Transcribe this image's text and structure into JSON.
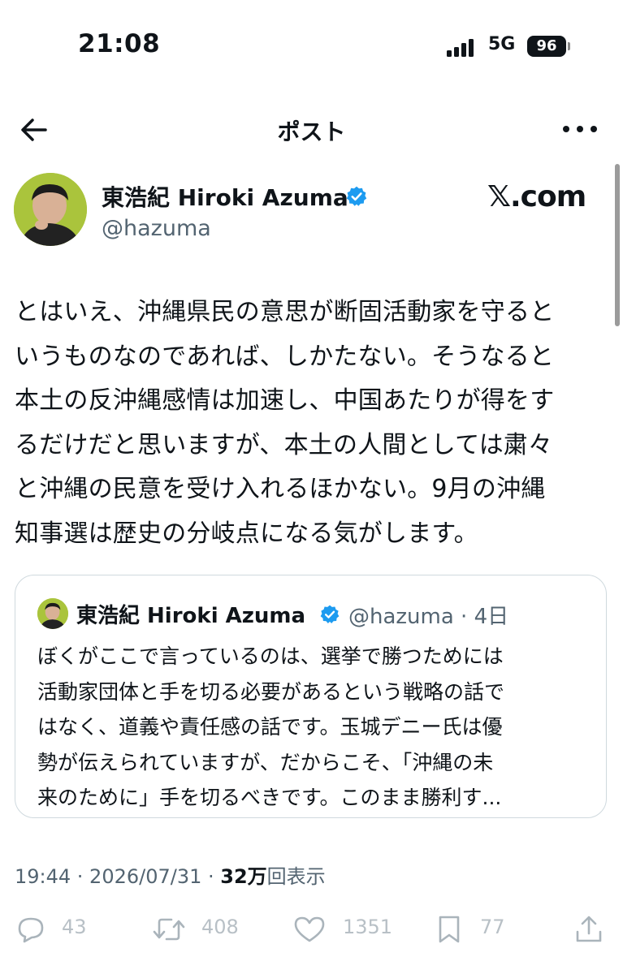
{
  "status_bar": {
    "time": "21:08",
    "network": "5G",
    "battery": "96"
  },
  "nav": {
    "title": "ポスト"
  },
  "author": {
    "name": "東浩紀 Hiroki Azuma",
    "handle": "@hazuma",
    "source_badge": "𝕏.com"
  },
  "post": {
    "lines": [
      "とはいえ、沖縄県民の意思が断固活動家を守ると",
      "いうものなのであれば、しかたない。そうなると",
      "本土の反沖縄感情は加速し、中国あたりが得をす",
      "るだけだと思いますが、本土の人間としては粛々",
      "と沖縄の民意を受け入れるほかない。9月の沖縄",
      "知事選は歴史の分岐点になる気がします。"
    ]
  },
  "quote": {
    "name": "東浩紀 Hiroki Azuma",
    "handle_time": "@hazuma · 4日",
    "lines": [
      "ぼくがここで言っているのは、選挙で勝つためには",
      "活動家団体と手を切る必要があるという戦略の話で",
      "はなく、道義や責任感の話です。玉城デニー氏は優",
      "勢が伝えられていますが、だからこそ、「沖縄の未",
      "来のために」手を切るべきです。このまま勝利す..."
    ]
  },
  "meta": {
    "time_date": "19:44 · 2026/07/31 · ",
    "views_count": "32万",
    "views_label": "回表示"
  },
  "actions": {
    "replies": "43",
    "reposts": "408",
    "likes": "1351",
    "bookmarks": "77"
  },
  "colors": {
    "verified": "#1d9bf0",
    "secondary_text": "#536471",
    "border": "#cfd9de",
    "action_icons": "#aab4bb"
  },
  "icons": [
    "back-arrow-icon",
    "more-icon",
    "verified-badge-icon",
    "reply-icon",
    "repost-icon",
    "like-icon",
    "bookmark-icon",
    "share-icon"
  ]
}
